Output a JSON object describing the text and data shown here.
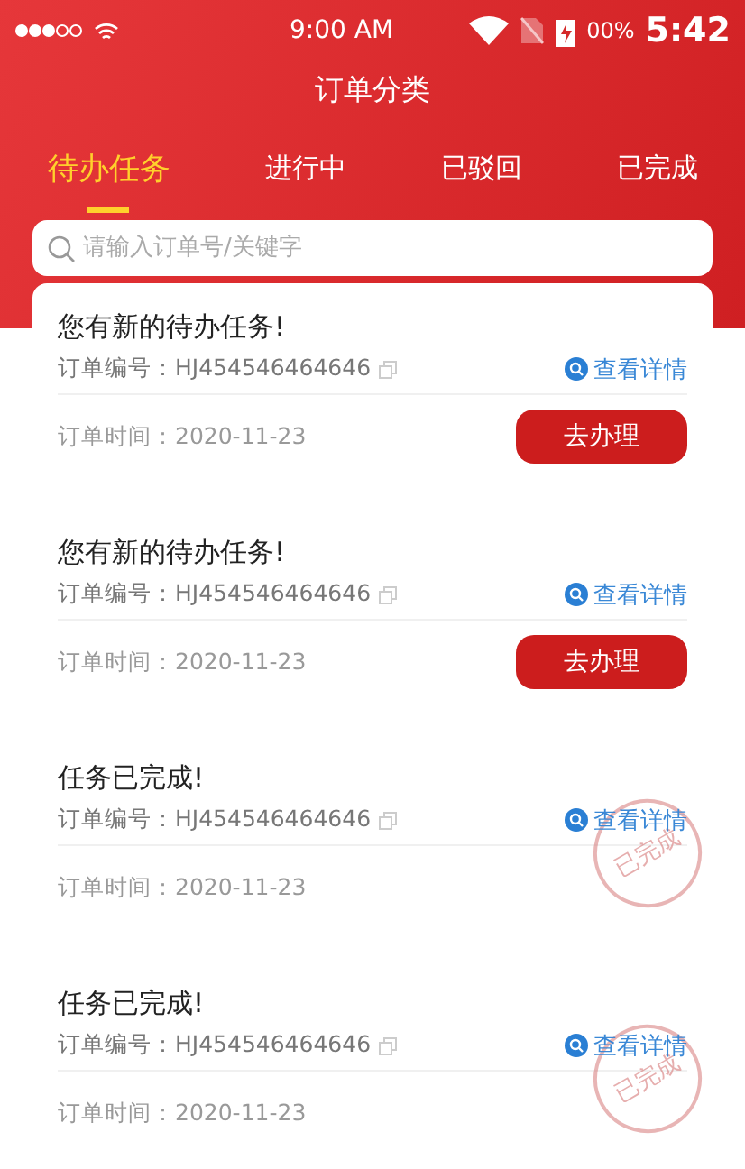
{
  "status_bar": {
    "carrier_time": "9:00 AM",
    "battery": "00%",
    "clock": "5:42"
  },
  "header": {
    "title": "订单分类"
  },
  "tabs": [
    {
      "label": "待办任务",
      "selected": true
    },
    {
      "label": "进行中",
      "selected": false
    },
    {
      "label": "已驳回",
      "selected": false
    },
    {
      "label": "已完成",
      "selected": false
    }
  ],
  "search": {
    "placeholder": "请输入订单号/关键字"
  },
  "orders": [
    {
      "title": "您有新的待办任务!",
      "number": "订单编号：HJ454546464646",
      "detail": "查看详情",
      "time": "订单时间：2020-11-23",
      "action": "去办理",
      "completed": false
    },
    {
      "title": "您有新的待办任务!",
      "number": "订单编号：HJ454546464646",
      "detail": "查看详情",
      "time": "订单时间：2020-11-23",
      "action": "去办理",
      "completed": false
    },
    {
      "title": "任务已完成!",
      "number": "订单编号：HJ454546464646",
      "detail": "查看详情",
      "time": "订单时间：2020-11-23",
      "stamp": "已完成",
      "completed": true
    },
    {
      "title": "任务已完成!",
      "number": "订单编号：HJ454546464646",
      "detail": "查看详情",
      "time": "订单时间：2020-11-23",
      "stamp": "已完成",
      "completed": true
    }
  ]
}
